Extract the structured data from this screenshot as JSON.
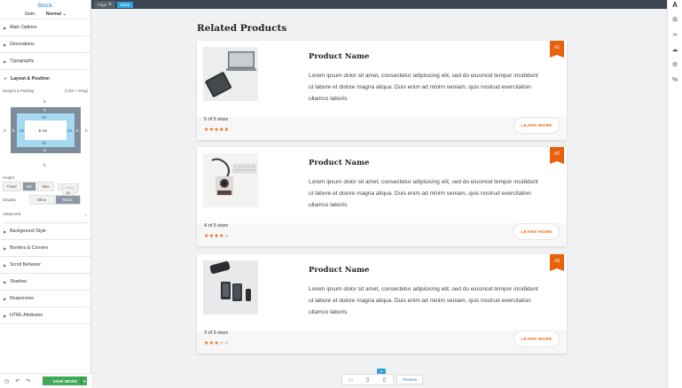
{
  "panel": {
    "title": "Block",
    "state_label": "Static",
    "state_value": "Normal",
    "sections_top": [
      "Main Options",
      "Decorations",
      "Typography"
    ],
    "layout_section": "Layout & Position",
    "margins_label": "Margins & Padding",
    "margins_hint": "(Click + Drag)",
    "box": {
      "margin_top": "0",
      "margin_bottom": "0",
      "margin_left": "0",
      "margin_right": "0",
      "border_top": "0",
      "border_bottom": "0",
      "border_left": "0",
      "border_right": "0",
      "padding_top": "40",
      "padding_bottom": "40",
      "padding_left": "20",
      "padding_right": "20",
      "content": "⊕ 96"
    },
    "height_label": "Height",
    "height_options": [
      "Fixed",
      "Min",
      "Max"
    ],
    "height_value": "auto",
    "height_unit": "px",
    "display_label": "Display",
    "display_options": [
      "Inline",
      "Block"
    ],
    "advanced_label": "Advanced",
    "sections_bottom": [
      "Background Style",
      "Borders & Corners",
      "Scroll Behavior",
      "Shadow",
      "Responsive",
      "HTML Attributes"
    ],
    "save_label": "SAVE WORK"
  },
  "breadcrumbs": [
    "Page",
    "Block"
  ],
  "canvas": {
    "heading": "Related Products",
    "products": [
      {
        "rank": "#1",
        "name": "Product Name",
        "description": "Lorem ipsum dolor sit amet, consectetur adipisicing elit, sed do eiusmod tempor incididunt ut labore et dolore magna aliqua. Duis enim ad minim veniam, quis nostrud exercitation ullamco laboris",
        "rating_text": "5 of 5 stars",
        "rating": 5,
        "button": "LEARN MORE"
      },
      {
        "rank": "#2",
        "name": "Product Name",
        "description": "Lorem ipsum dolor sit amet, consectetur adipisicing elit, sed do eiusmod tempor incididunt ut labore et dolore magna aliqua. Duis enim ad minim veniam, quis nostrud exercitation ullamco laboris",
        "rating_text": "4 of 5 stars",
        "rating": 4,
        "button": "LEARN MORE"
      },
      {
        "rank": "#3",
        "name": "Product Name",
        "description": "Lorem ipsum dolor sit amet, consectetur adipisicing elit, sed do eiusmod tempor incididunt ut labore et dolore magna aliqua. Duis enim ad minim veniam, quis nostrud exercitation ullamco laboris",
        "rating_text": "3 of 5 stars",
        "rating": 3,
        "button": "LEARN MORE"
      }
    ]
  },
  "bottom": {
    "preview_label": "Preview",
    "devices": [
      "desktop-icon",
      "tablet-icon",
      "phone-icon"
    ]
  },
  "colors": {
    "accent": "#e8620c",
    "primary": "#2da0dc",
    "save": "#3eaa57",
    "topbar": "#3b4451"
  }
}
